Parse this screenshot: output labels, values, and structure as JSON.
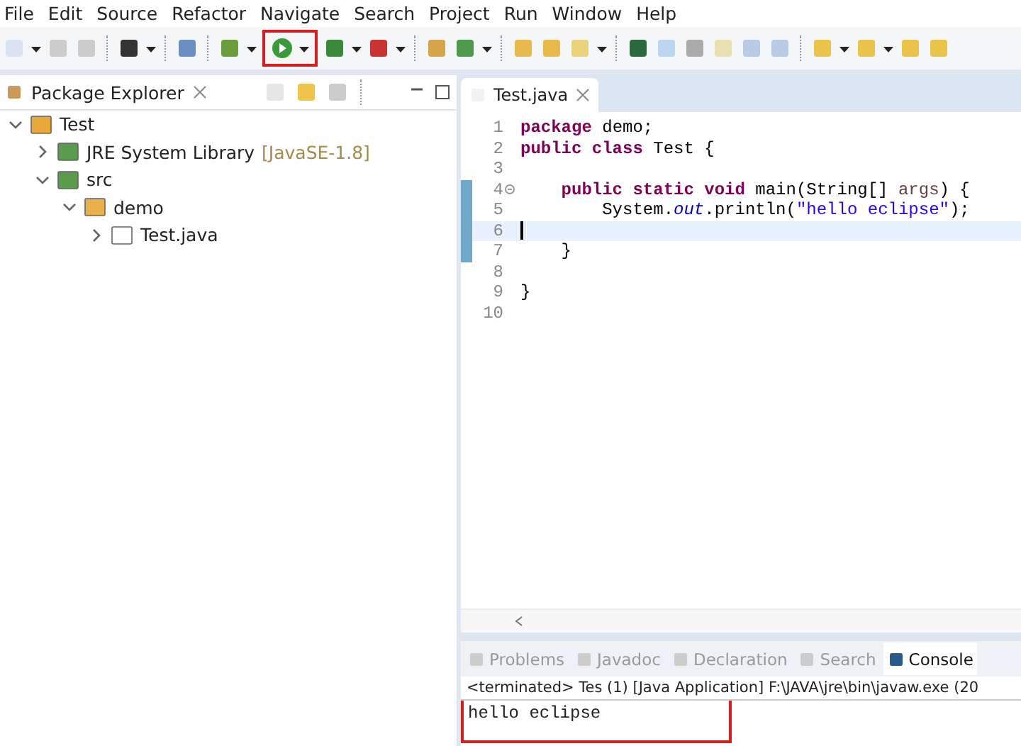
{
  "menu": [
    "File",
    "Edit",
    "Source",
    "Refactor",
    "Navigate",
    "Search",
    "Project",
    "Run",
    "Window",
    "Help"
  ],
  "run_button": {
    "highlighted": true
  },
  "package_explorer": {
    "title": "Package Explorer",
    "tree": [
      {
        "label": "Test",
        "expanded": true,
        "children": [
          {
            "label": "JRE System Library",
            "decoration": "[JavaSE-1.8]",
            "expanded": false
          },
          {
            "label": "src",
            "expanded": true,
            "children": [
              {
                "label": "demo",
                "expanded": true,
                "children": [
                  {
                    "label": "Test.java",
                    "expanded": false
                  }
                ]
              }
            ]
          }
        ]
      }
    ]
  },
  "editor": {
    "tab": "Test.java",
    "lines": [
      {
        "number": "1",
        "folded_marker": false,
        "marked": false,
        "current": false,
        "tokens": [
          {
            "kind": "keyword",
            "text": "package"
          },
          {
            "kind": "plain",
            "text": " demo;"
          }
        ]
      },
      {
        "number": "2",
        "folded_marker": false,
        "marked": false,
        "current": false,
        "tokens": [
          {
            "kind": "keyword",
            "text": "public class"
          },
          {
            "kind": "plain",
            "text": " Test {"
          }
        ]
      },
      {
        "number": "3",
        "folded_marker": false,
        "marked": false,
        "current": false
      },
      {
        "number": "4",
        "folded_marker": true,
        "marked": true,
        "current": false,
        "tokens": [
          {
            "kind": "keyword",
            "text": "    public static void"
          },
          {
            "kind": "plain",
            "text": " main(String[] "
          },
          {
            "kind": "param",
            "text": "args"
          },
          {
            "kind": "plain",
            "text": ") {"
          }
        ]
      },
      {
        "number": "5",
        "folded_marker": false,
        "marked": true,
        "current": false,
        "tokens": [
          {
            "kind": "plain",
            "text": "        System."
          },
          {
            "kind": "field",
            "text": "out"
          },
          {
            "kind": "plain",
            "text": ".println("
          },
          {
            "kind": "string",
            "text": "\"hello eclipse\""
          },
          {
            "kind": "plain",
            "text": ");"
          }
        ]
      },
      {
        "number": "6",
        "folded_marker": false,
        "marked": true,
        "current": true
      },
      {
        "number": "7",
        "folded_marker": false,
        "marked": true,
        "current": false,
        "tokens": [
          {
            "kind": "plain",
            "text": "    }"
          }
        ]
      },
      {
        "number": "8",
        "folded_marker": false,
        "marked": false,
        "current": false
      },
      {
        "number": "9",
        "folded_marker": false,
        "marked": false,
        "current": false,
        "tokens": [
          {
            "kind": "plain",
            "text": "}"
          }
        ]
      },
      {
        "number": "10",
        "folded_marker": false,
        "marked": false,
        "current": false
      }
    ]
  },
  "bottom_tabs": [
    {
      "label": "Problems",
      "selected": false
    },
    {
      "label": "Javadoc",
      "selected": false
    },
    {
      "label": "Declaration",
      "selected": false
    },
    {
      "label": "Search",
      "selected": false
    },
    {
      "label": "Console",
      "selected": true
    }
  ],
  "console": {
    "header": "<terminated> Tes  (1) [Java Application] F:\\JAVA\\jre\\bin\\javaw.exe (20",
    "output": "hello eclipse",
    "highlighted": true
  }
}
